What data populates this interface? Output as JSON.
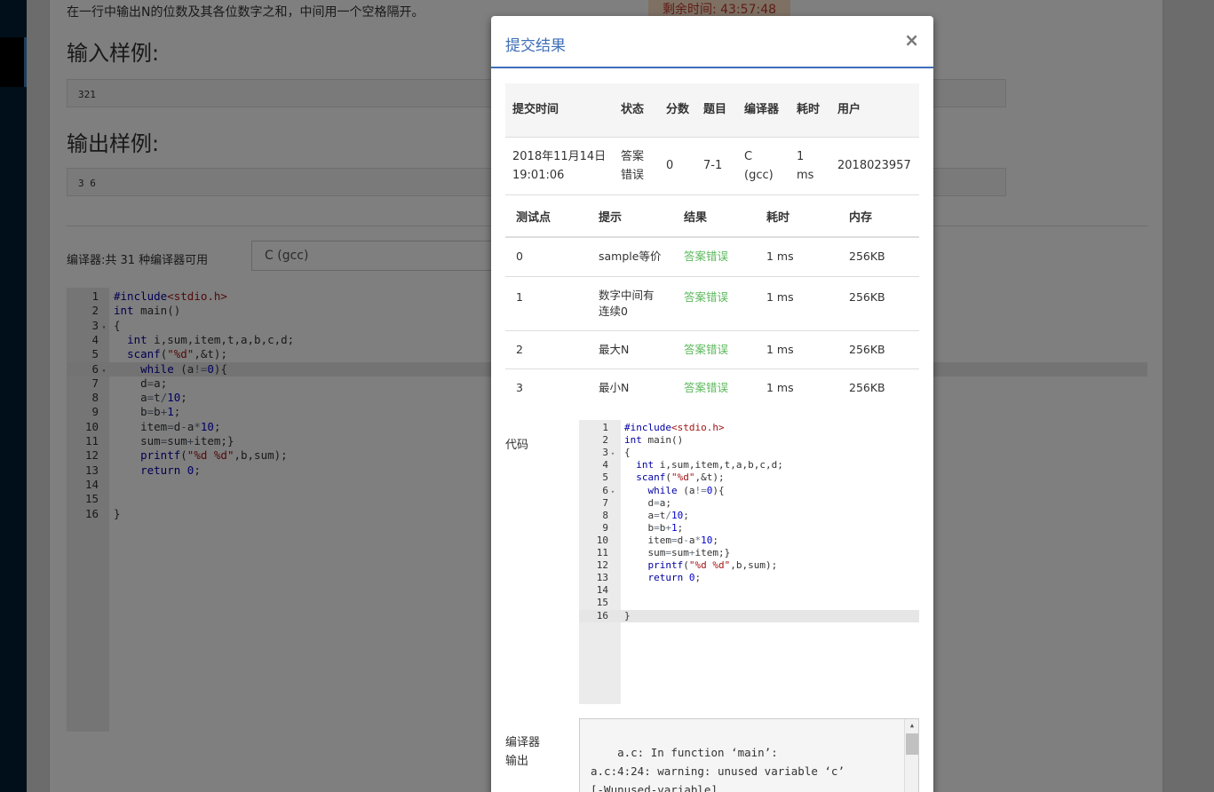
{
  "background": {
    "problem_desc": "在一行中输出N的位数及其各位数字之和，中间用一个空格隔开。",
    "timer": "剩余时间: 43:57:48",
    "input_sample_title": "输入样例:",
    "input_sample_value": "321",
    "output_sample_title": "输出样例:",
    "output_sample_value": "3 6",
    "compiler_label": "编译器:共 31 种编译器可用",
    "compiler_selected": "C (gcc)"
  },
  "modal": {
    "title": "提交结果",
    "close_glyph": "×",
    "summary": {
      "headers": [
        "提交时间",
        "状态",
        "分数",
        "题目",
        "编译器",
        "耗时",
        "用户"
      ],
      "row": {
        "time": "2018年11月14日 19:01:06",
        "status": "答案错误",
        "score": "0",
        "problem": "7-1",
        "compiler": "C (gcc)",
        "duration": "1 ms",
        "user": "2018023957"
      }
    },
    "cases": {
      "headers": [
        "测试点",
        "提示",
        "结果",
        "耗时",
        "内存"
      ],
      "rows": [
        {
          "id": "0",
          "hint": "sample等价",
          "result": "答案错误",
          "time": "1 ms",
          "memory": "256KB"
        },
        {
          "id": "1",
          "hint": "数字中间有连续0",
          "result": "答案错误",
          "time": "1 ms",
          "memory": "256KB"
        },
        {
          "id": "2",
          "hint": "最大N",
          "result": "答案错误",
          "time": "1 ms",
          "memory": "256KB"
        },
        {
          "id": "3",
          "hint": "最小N",
          "result": "答案错误",
          "time": "1 ms",
          "memory": "256KB"
        }
      ]
    },
    "code_label": "代码",
    "compiler_output_label": "编译器输出",
    "compiler_output": "a.c: In function ‘main’:\na.c:4:24: warning: unused variable ‘c’\n[-Wunused-variable]\n   int i,sum,item,t,a,b,c,d;"
  },
  "code_lines": [
    {
      "n": "1",
      "fold": false,
      "html": "<span class=\"k\">#include</span><span class=\"s\">&lt;stdio.h&gt;</span>"
    },
    {
      "n": "2",
      "fold": false,
      "html": "<span class=\"k\">int</span> main()"
    },
    {
      "n": "3",
      "fold": true,
      "html": "{"
    },
    {
      "n": "4",
      "fold": false,
      "html": "  <span class=\"k\">int</span> i,sum,item,t,a,b,c,d;"
    },
    {
      "n": "5",
      "fold": false,
      "html": "  <span class=\"k\">scanf</span>(<span class=\"s\">\"%d\"</span>,&amp;t);"
    },
    {
      "n": "6",
      "fold": true,
      "html": "    <span class=\"k\">while</span> (a<span class=\"o\">!=</span><span class=\"n\">0</span>){"
    },
    {
      "n": "7",
      "fold": false,
      "html": "    d<span class=\"o\">=</span>a;"
    },
    {
      "n": "8",
      "fold": false,
      "html": "    a<span class=\"o\">=</span>t<span class=\"o\">/</span><span class=\"n\">10</span>;"
    },
    {
      "n": "9",
      "fold": false,
      "html": "    b<span class=\"o\">=</span>b<span class=\"o\">+</span><span class=\"n\">1</span>;"
    },
    {
      "n": "10",
      "fold": false,
      "html": "    item<span class=\"o\">=</span>d<span class=\"o\">-</span>a<span class=\"o\">*</span><span class=\"n\">10</span>;"
    },
    {
      "n": "11",
      "fold": false,
      "html": "    sum<span class=\"o\">=</span>sum<span class=\"o\">+</span>item;}"
    },
    {
      "n": "12",
      "fold": false,
      "html": "    <span class=\"k\">printf</span>(<span class=\"s\">\"%d %d\"</span>,b,sum);"
    },
    {
      "n": "13",
      "fold": false,
      "html": "    <span class=\"k\">return</span> <span class=\"n\">0</span>;"
    },
    {
      "n": "14",
      "fold": false,
      "html": ""
    },
    {
      "n": "15",
      "fold": false,
      "html": ""
    },
    {
      "n": "16",
      "fold": false,
      "html": "}"
    }
  ]
}
